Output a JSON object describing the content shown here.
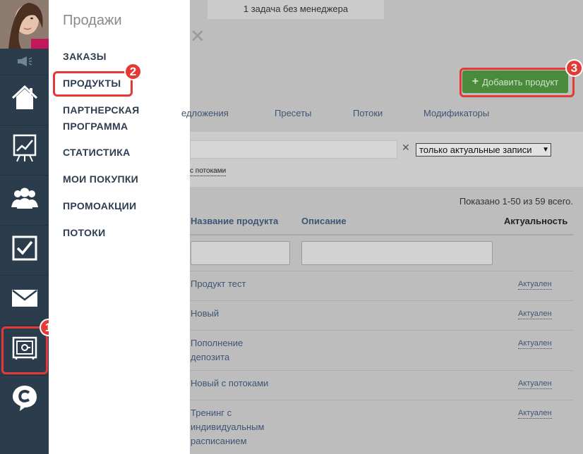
{
  "menu": {
    "title": "Продажи",
    "items": [
      "ЗАКАЗЫ",
      "ПРОДУКТЫ",
      "ПАРТНЕРСКАЯ ПРОГРАММА",
      "СТАТИСТИКА",
      "МОИ ПОКУПКИ",
      "ПРОМОАКЦИИ",
      "ПОТОКИ"
    ]
  },
  "rail": {
    "icons": [
      "home-icon",
      "chart-board-icon",
      "users-icon",
      "checkbox-icon",
      "mail-icon",
      "safe-icon",
      "chat-c-icon"
    ],
    "badge_settings": "1"
  },
  "badges": {
    "products": "2",
    "add": "3"
  },
  "main": {
    "notice": "1 задача без менеджера",
    "add_button": "Добавить продукт",
    "tabs": [
      "едложения",
      "Пресеты",
      "Потоки",
      "Модификаторы"
    ],
    "filter": {
      "select_value": "только актуальные записи",
      "flows_link": "с потоками"
    },
    "shown": "Показано 1-50 из 59 всего.",
    "columns": {
      "name": "Название продукта",
      "description": "Описание",
      "actuality": "Актуальность"
    },
    "rows": [
      {
        "name": "Продукт тест",
        "status": "Актуален"
      },
      {
        "name": "Новый",
        "status": "Актуален"
      },
      {
        "name": "Пополнение депозита",
        "status": "Актуален"
      },
      {
        "name": "Новый с потоками",
        "status": "Актуален"
      },
      {
        "name": "Тренинг с индивидуальным расписанием",
        "status": "Актуален"
      }
    ]
  },
  "colors": {
    "rail": "#2b3d4c",
    "accent_red": "#e53935",
    "green_button": "#4a8a3c",
    "link": "#3e5674"
  }
}
